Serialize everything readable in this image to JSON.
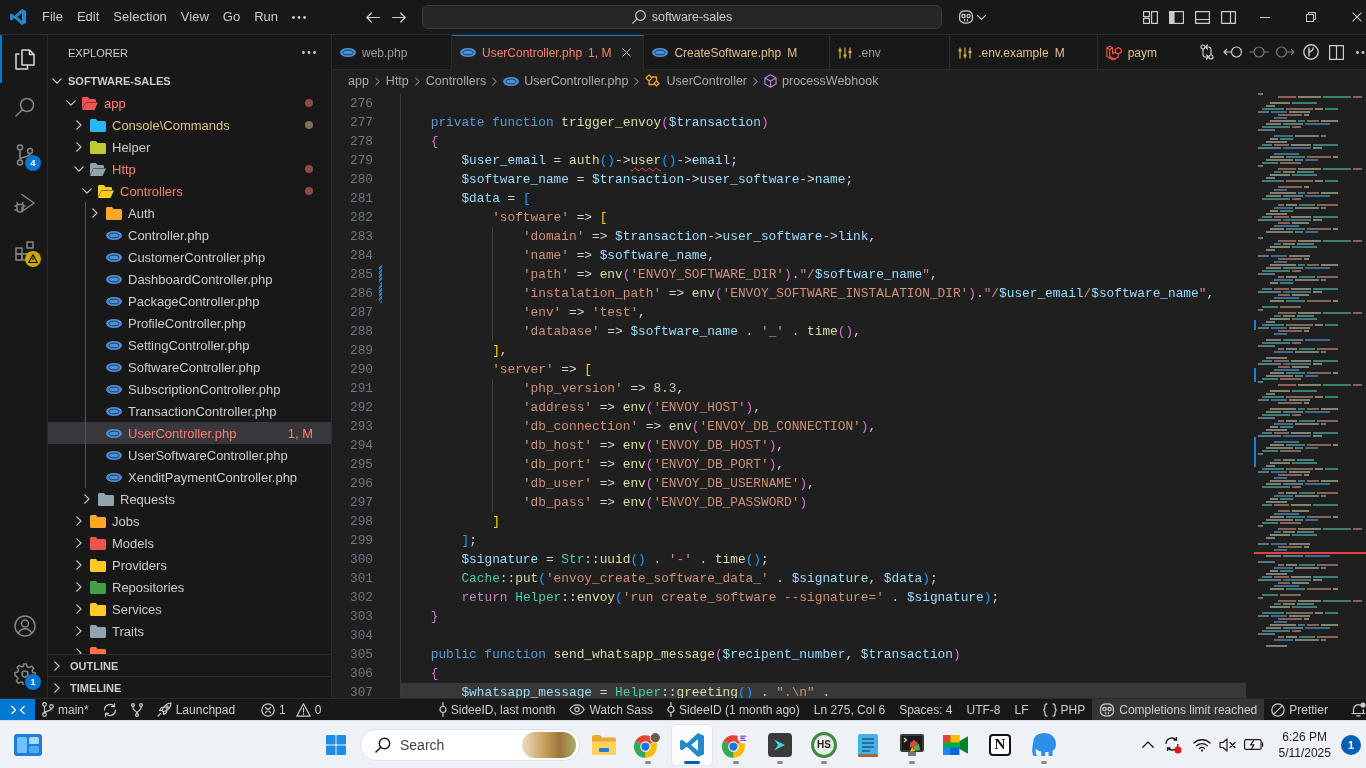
{
  "title_bar": {
    "menus": [
      "File",
      "Edit",
      "Selection",
      "View",
      "Go",
      "Run"
    ],
    "command_center": "software-sales"
  },
  "activity_bar": {
    "top": [
      {
        "kind": "explorer",
        "selected": true,
        "warning": false
      },
      {
        "kind": "search",
        "selected": false,
        "warning": false
      },
      {
        "kind": "scm",
        "selected": false,
        "warning": false,
        "badge": "4"
      },
      {
        "kind": "debug",
        "selected": false,
        "warning": false
      },
      {
        "kind": "extensions",
        "selected": false,
        "warning": true
      }
    ],
    "bottom": [
      {
        "kind": "account"
      },
      {
        "kind": "manage",
        "badge": "1"
      }
    ]
  },
  "explorer": {
    "title": "EXPLORER",
    "folder": {
      "name": "SOFTWARE-SALES",
      "expanded": true
    },
    "tree": [
      {
        "name": "app",
        "kind": "folder",
        "color": "#ef5350",
        "expanded": true,
        "selected": false,
        "error": true,
        "modified": false,
        "children": [
          {
            "name": "Console\\Commands",
            "kind": "folder",
            "color": "#29b6f6",
            "expanded": false,
            "selected": false,
            "error": false,
            "modified": true
          },
          {
            "name": "Helper",
            "kind": "folder",
            "color": "#c0ca33",
            "expanded": false,
            "selected": false,
            "error": false,
            "modified": false
          },
          {
            "name": "Http",
            "kind": "folder",
            "color": "#90a4ae",
            "expanded": true,
            "selected": false,
            "error": true,
            "modified": false,
            "children": [
              {
                "name": "Controllers",
                "kind": "folder",
                "color": "#ffca28",
                "expanded": true,
                "selected": false,
                "error": true,
                "modified": false,
                "children": [
                  {
                    "name": "Auth",
                    "kind": "folder",
                    "color": "#ffa726",
                    "expanded": false,
                    "selected": false,
                    "error": false,
                    "modified": false
                  },
                  {
                    "name": "Controller.php",
                    "kind": "file",
                    "selected": false,
                    "error": false,
                    "modified": false
                  },
                  {
                    "name": "CustomerController.php",
                    "kind": "file",
                    "selected": false,
                    "error": false,
                    "modified": false
                  },
                  {
                    "name": "DashboardController.php",
                    "kind": "file",
                    "selected": false,
                    "error": false,
                    "modified": false
                  },
                  {
                    "name": "PackageController.php",
                    "kind": "file",
                    "selected": false,
                    "error": false,
                    "modified": false
                  },
                  {
                    "name": "ProfileController.php",
                    "kind": "file",
                    "selected": false,
                    "error": false,
                    "modified": false
                  },
                  {
                    "name": "SettingController.php",
                    "kind": "file",
                    "selected": false,
                    "error": false,
                    "modified": false
                  },
                  {
                    "name": "SoftwareController.php",
                    "kind": "file",
                    "selected": false,
                    "error": false,
                    "modified": false
                  },
                  {
                    "name": "SubscriptionController.php",
                    "kind": "file",
                    "selected": false,
                    "error": false,
                    "modified": false
                  },
                  {
                    "name": "TransactionController.php",
                    "kind": "file",
                    "selected": false,
                    "error": false,
                    "modified": false
                  },
                  {
                    "name": "UserController.php",
                    "kind": "file",
                    "selected": true,
                    "error": true,
                    "modified": false,
                    "badge": "1, M"
                  },
                  {
                    "name": "UserSoftwareController.php",
                    "kind": "file",
                    "selected": false,
                    "error": false,
                    "modified": false
                  },
                  {
                    "name": "XenditPaymentController.php",
                    "kind": "file",
                    "selected": false,
                    "error": false,
                    "modified": false
                  }
                ]
              },
              {
                "name": "Requests",
                "kind": "folder",
                "color": "#90a4ae",
                "expanded": false,
                "selected": false,
                "error": false,
                "modified": false
              }
            ]
          },
          {
            "name": "Jobs",
            "kind": "folder",
            "color": "#ffa726",
            "expanded": false,
            "selected": false,
            "error": false,
            "modified": false
          },
          {
            "name": "Models",
            "kind": "folder",
            "color": "#ef5350",
            "expanded": false,
            "selected": false,
            "error": false,
            "modified": false
          },
          {
            "name": "Providers",
            "kind": "folder",
            "color": "#ffca28",
            "expanded": false,
            "selected": false,
            "error": false,
            "modified": false
          },
          {
            "name": "Repositories",
            "kind": "folder",
            "color": "#43a047",
            "expanded": false,
            "selected": false,
            "error": false,
            "modified": false
          },
          {
            "name": "Services",
            "kind": "folder",
            "color": "#ffca28",
            "expanded": false,
            "selected": false,
            "error": false,
            "modified": false
          },
          {
            "name": "Traits",
            "kind": "folder",
            "color": "#90a4ae",
            "expanded": false,
            "selected": false,
            "error": false,
            "modified": false
          },
          {
            "kind": "folder",
            "color": "#ff7043",
            "expanded": false,
            "selected": false,
            "error": false,
            "modified": false
          }
        ]
      }
    ],
    "sections": [
      {
        "name": "OUTLINE",
        "expanded": false
      },
      {
        "name": "TIMELINE",
        "expanded": false
      }
    ]
  },
  "tabs": [
    {
      "label": "web.php",
      "kind": "php",
      "selected": false,
      "error": false,
      "modified": false
    },
    {
      "label": "UserController.php",
      "kind": "php",
      "selected": true,
      "error": true,
      "modified": false,
      "badge": "1, M"
    },
    {
      "label": "CreateSoftware.php",
      "kind": "php",
      "selected": false,
      "error": false,
      "modified": true,
      "badge": "M"
    },
    {
      "label": ".env",
      "kind": "env",
      "selected": false,
      "error": false,
      "modified": false
    },
    {
      "label": ".env.example",
      "kind": "env",
      "selected": false,
      "error": false,
      "modified": true,
      "badge": "M"
    },
    {
      "label": "paym",
      "kind": "laravel",
      "selected": false,
      "error": false,
      "modified": true
    }
  ],
  "breadcrumbs": [
    {
      "label": "app",
      "kind": "folder"
    },
    {
      "label": "Http",
      "kind": "folder"
    },
    {
      "label": "Controllers",
      "kind": "folder"
    },
    {
      "label": "UserController.php",
      "kind": "php"
    },
    {
      "label": "UserController",
      "kind": "class"
    },
    {
      "label": "processWebhook",
      "kind": "method"
    }
  ],
  "editor": {
    "lines": [
      {
        "number": "276",
        "modified": false,
        "highlighted": false
      },
      {
        "number": "277",
        "modified": false,
        "highlighted": false,
        "tokens": [
          {
            "kind": "keyword",
            "text": "    private function "
          },
          {
            "kind": "function",
            "text": "trigger_envoy"
          },
          {
            "kind": "bracket2",
            "text": "("
          },
          {
            "kind": "variable",
            "text": "$transaction"
          },
          {
            "kind": "bracket2",
            "text": ")"
          }
        ]
      },
      {
        "number": "278",
        "modified": false,
        "highlighted": false,
        "tokens": [
          {
            "kind": "bracket2",
            "text": "    {"
          }
        ]
      },
      {
        "number": "279",
        "modified": false,
        "highlighted": false,
        "tokens": [
          {
            "kind": "variable",
            "text": "        $user_email"
          },
          {
            "kind": "plain",
            "text": " = "
          },
          {
            "kind": "function",
            "text": "auth"
          },
          {
            "kind": "bracket3",
            "text": "()"
          },
          {
            "kind": "plain",
            "text": "->"
          },
          {
            "kind": "flagged",
            "text": "user"
          },
          {
            "kind": "bracket3",
            "text": "()"
          },
          {
            "kind": "plain",
            "text": "->"
          },
          {
            "kind": "variable",
            "text": "email"
          },
          {
            "kind": "plain",
            "text": ";"
          }
        ]
      },
      {
        "number": "280",
        "modified": false,
        "highlighted": false,
        "tokens": [
          {
            "kind": "variable",
            "text": "        $software_name"
          },
          {
            "kind": "plain",
            "text": " = "
          },
          {
            "kind": "variable",
            "text": "$transaction"
          },
          {
            "kind": "plain",
            "text": "->"
          },
          {
            "kind": "variable",
            "text": "user_software"
          },
          {
            "kind": "plain",
            "text": "->"
          },
          {
            "kind": "variable",
            "text": "name"
          },
          {
            "kind": "plain",
            "text": ";"
          }
        ]
      },
      {
        "number": "281",
        "modified": false,
        "highlighted": false,
        "tokens": [
          {
            "kind": "variable",
            "text": "        $data"
          },
          {
            "kind": "plain",
            "text": " = "
          },
          {
            "kind": "bracket3",
            "text": "["
          }
        ]
      },
      {
        "number": "282",
        "modified": false,
        "highlighted": false,
        "tokens": [
          {
            "kind": "string",
            "text": "            'software'"
          },
          {
            "kind": "plain",
            "text": " => "
          },
          {
            "kind": "bracket1",
            "text": "["
          }
        ]
      },
      {
        "number": "283",
        "modified": false,
        "highlighted": false,
        "tokens": [
          {
            "kind": "string",
            "text": "                'domain'"
          },
          {
            "kind": "plain",
            "text": " => "
          },
          {
            "kind": "variable",
            "text": "$transaction"
          },
          {
            "kind": "plain",
            "text": "->"
          },
          {
            "kind": "variable",
            "text": "user_software"
          },
          {
            "kind": "plain",
            "text": "->"
          },
          {
            "kind": "variable",
            "text": "link"
          },
          {
            "kind": "plain",
            "text": ","
          }
        ]
      },
      {
        "number": "284",
        "modified": false,
        "highlighted": false,
        "tokens": [
          {
            "kind": "string",
            "text": "                'name'"
          },
          {
            "kind": "plain",
            "text": " => "
          },
          {
            "kind": "variable",
            "text": "$software_name"
          },
          {
            "kind": "plain",
            "text": ","
          }
        ]
      },
      {
        "number": "285",
        "modified": true,
        "highlighted": false,
        "tokens": [
          {
            "kind": "string",
            "text": "                'path'"
          },
          {
            "kind": "plain",
            "text": " => "
          },
          {
            "kind": "function",
            "text": "env"
          },
          {
            "kind": "bracket2",
            "text": "("
          },
          {
            "kind": "string",
            "text": "'ENVOY_SOFTWARE_DIR'"
          },
          {
            "kind": "bracket2",
            "text": ")"
          },
          {
            "kind": "plain",
            "text": "."
          },
          {
            "kind": "string",
            "text": "\"/"
          },
          {
            "kind": "variable",
            "text": "$software_name"
          },
          {
            "kind": "string",
            "text": "\""
          },
          {
            "kind": "plain",
            "text": ","
          }
        ]
      },
      {
        "number": "286",
        "modified": true,
        "highlighted": false,
        "tokens": [
          {
            "kind": "string",
            "text": "                'instalation_path'"
          },
          {
            "kind": "plain",
            "text": " => "
          },
          {
            "kind": "function",
            "text": "env"
          },
          {
            "kind": "bracket2",
            "text": "("
          },
          {
            "kind": "string",
            "text": "'ENVOY_SOFTWARE_INSTALATION_DIR'"
          },
          {
            "kind": "bracket2",
            "text": ")"
          },
          {
            "kind": "plain",
            "text": "."
          },
          {
            "kind": "string",
            "text": "\"/"
          },
          {
            "kind": "variable",
            "text": "$user_email"
          },
          {
            "kind": "string",
            "text": "/"
          },
          {
            "kind": "variable",
            "text": "$software_name"
          },
          {
            "kind": "string",
            "text": "\""
          },
          {
            "kind": "plain",
            "text": ","
          }
        ]
      },
      {
        "number": "287",
        "modified": false,
        "highlighted": false,
        "tokens": [
          {
            "kind": "string",
            "text": "                'env'"
          },
          {
            "kind": "plain",
            "text": " => "
          },
          {
            "kind": "string",
            "text": "'test'"
          },
          {
            "kind": "plain",
            "text": ","
          }
        ]
      },
      {
        "number": "288",
        "modified": false,
        "highlighted": false,
        "tokens": [
          {
            "kind": "string",
            "text": "                'database'"
          },
          {
            "kind": "plain",
            "text": " => "
          },
          {
            "kind": "variable",
            "text": "$software_name"
          },
          {
            "kind": "plain",
            "text": " . "
          },
          {
            "kind": "string",
            "text": "'_'"
          },
          {
            "kind": "plain",
            "text": " . "
          },
          {
            "kind": "function",
            "text": "time"
          },
          {
            "kind": "bracket2",
            "text": "()"
          },
          {
            "kind": "plain",
            "text": ","
          }
        ]
      },
      {
        "number": "289",
        "modified": false,
        "highlighted": false,
        "tokens": [
          {
            "kind": "bracket1",
            "text": "            ]"
          },
          {
            "kind": "plain",
            "text": ","
          }
        ]
      },
      {
        "number": "290",
        "modified": false,
        "highlighted": false,
        "tokens": [
          {
            "kind": "string",
            "text": "            'server'"
          },
          {
            "kind": "plain",
            "text": " => "
          },
          {
            "kind": "bracket1",
            "text": "["
          }
        ]
      },
      {
        "number": "291",
        "modified": false,
        "highlighted": false,
        "tokens": [
          {
            "kind": "string",
            "text": "                'php_version'"
          },
          {
            "kind": "plain",
            "text": " => "
          },
          {
            "kind": "number",
            "text": "8.3"
          },
          {
            "kind": "plain",
            "text": ","
          }
        ]
      },
      {
        "number": "292",
        "modified": false,
        "highlighted": false,
        "tokens": [
          {
            "kind": "string",
            "text": "                'address'"
          },
          {
            "kind": "plain",
            "text": " => "
          },
          {
            "kind": "function",
            "text": "env"
          },
          {
            "kind": "bracket2",
            "text": "("
          },
          {
            "kind": "string",
            "text": "'ENVOY_HOST'"
          },
          {
            "kind": "bracket2",
            "text": ")"
          },
          {
            "kind": "plain",
            "text": ","
          }
        ]
      },
      {
        "number": "293",
        "modified": false,
        "highlighted": false,
        "tokens": [
          {
            "kind": "string",
            "text": "                'db_connection'"
          },
          {
            "kind": "plain",
            "text": " => "
          },
          {
            "kind": "function",
            "text": "env"
          },
          {
            "kind": "bracket2",
            "text": "("
          },
          {
            "kind": "string",
            "text": "'ENVOY_DB_CONNECTION'"
          },
          {
            "kind": "bracket2",
            "text": ")"
          },
          {
            "kind": "plain",
            "text": ","
          }
        ]
      },
      {
        "number": "294",
        "modified": false,
        "highlighted": false,
        "tokens": [
          {
            "kind": "string",
            "text": "                'db_host'"
          },
          {
            "kind": "plain",
            "text": " => "
          },
          {
            "kind": "function",
            "text": "env"
          },
          {
            "kind": "bracket2",
            "text": "("
          },
          {
            "kind": "string",
            "text": "'ENVOY_DB_HOST'"
          },
          {
            "kind": "bracket2",
            "text": ")"
          },
          {
            "kind": "plain",
            "text": ","
          }
        ]
      },
      {
        "number": "295",
        "modified": false,
        "highlighted": false,
        "tokens": [
          {
            "kind": "string",
            "text": "                'db_port'"
          },
          {
            "kind": "plain",
            "text": " => "
          },
          {
            "kind": "function",
            "text": "env"
          },
          {
            "kind": "bracket2",
            "text": "("
          },
          {
            "kind": "string",
            "text": "'ENVOY_DB_PORT'"
          },
          {
            "kind": "bracket2",
            "text": ")"
          },
          {
            "kind": "plain",
            "text": ","
          }
        ]
      },
      {
        "number": "296",
        "modified": false,
        "highlighted": false,
        "tokens": [
          {
            "kind": "string",
            "text": "                'db_user'"
          },
          {
            "kind": "plain",
            "text": " => "
          },
          {
            "kind": "function",
            "text": "env"
          },
          {
            "kind": "bracket2",
            "text": "("
          },
          {
            "kind": "string",
            "text": "'ENVOY_DB_USERNAME'"
          },
          {
            "kind": "bracket2",
            "text": ")"
          },
          {
            "kind": "plain",
            "text": ","
          }
        ]
      },
      {
        "number": "297",
        "modified": false,
        "highlighted": false,
        "tokens": [
          {
            "kind": "string",
            "text": "                'db_pass'"
          },
          {
            "kind": "plain",
            "text": " => "
          },
          {
            "kind": "function",
            "text": "env"
          },
          {
            "kind": "bracket2",
            "text": "("
          },
          {
            "kind": "string",
            "text": "'ENVOY_DB_PASSWORD'"
          },
          {
            "kind": "bracket2",
            "text": ")"
          }
        ]
      },
      {
        "number": "298",
        "modified": false,
        "highlighted": false,
        "tokens": [
          {
            "kind": "bracket1",
            "text": "            ]"
          }
        ]
      },
      {
        "number": "299",
        "modified": false,
        "highlighted": false,
        "tokens": [
          {
            "kind": "bracket3",
            "text": "        ]"
          },
          {
            "kind": "plain",
            "text": ";"
          }
        ]
      },
      {
        "number": "300",
        "modified": false,
        "highlighted": false,
        "tokens": [
          {
            "kind": "variable",
            "text": "        $signature"
          },
          {
            "kind": "plain",
            "text": " = "
          },
          {
            "kind": "class",
            "text": "Str"
          },
          {
            "kind": "plain",
            "text": "::"
          },
          {
            "kind": "function",
            "text": "uuid"
          },
          {
            "kind": "bracket3",
            "text": "()"
          },
          {
            "kind": "plain",
            "text": " . "
          },
          {
            "kind": "string",
            "text": "'-'"
          },
          {
            "kind": "plain",
            "text": " . "
          },
          {
            "kind": "function",
            "text": "time"
          },
          {
            "kind": "bracket3",
            "text": "()"
          },
          {
            "kind": "plain",
            "text": ";"
          }
        ]
      },
      {
        "number": "301",
        "modified": false,
        "highlighted": false,
        "tokens": [
          {
            "kind": "class",
            "text": "        Cache"
          },
          {
            "kind": "plain",
            "text": "::"
          },
          {
            "kind": "function",
            "text": "put"
          },
          {
            "kind": "bracket3",
            "text": "("
          },
          {
            "kind": "string",
            "text": "'envoy_create_software_data_'"
          },
          {
            "kind": "plain",
            "text": " . "
          },
          {
            "kind": "variable",
            "text": "$signature"
          },
          {
            "kind": "plain",
            "text": ", "
          },
          {
            "kind": "variable",
            "text": "$data"
          },
          {
            "kind": "bracket3",
            "text": ")"
          },
          {
            "kind": "plain",
            "text": ";"
          }
        ]
      },
      {
        "number": "302",
        "modified": false,
        "highlighted": false,
        "tokens": [
          {
            "kind": "control",
            "text": "        return "
          },
          {
            "kind": "class",
            "text": "Helper"
          },
          {
            "kind": "plain",
            "text": "::"
          },
          {
            "kind": "function",
            "text": "envoy"
          },
          {
            "kind": "bracket3",
            "text": "("
          },
          {
            "kind": "string",
            "text": "'run create_software --signature='"
          },
          {
            "kind": "plain",
            "text": " . "
          },
          {
            "kind": "variable",
            "text": "$signature"
          },
          {
            "kind": "bracket3",
            "text": ")"
          },
          {
            "kind": "plain",
            "text": ";"
          }
        ]
      },
      {
        "number": "303",
        "modified": false,
        "highlighted": false,
        "tokens": [
          {
            "kind": "bracket2",
            "text": "    }"
          }
        ]
      },
      {
        "number": "304",
        "modified": false,
        "highlighted": false
      },
      {
        "number": "305",
        "modified": false,
        "highlighted": false,
        "tokens": [
          {
            "kind": "keyword",
            "text": "    public function "
          },
          {
            "kind": "function",
            "text": "send_whatsapp_message"
          },
          {
            "kind": "bracket2",
            "text": "("
          },
          {
            "kind": "variable",
            "text": "$recipent_number"
          },
          {
            "kind": "plain",
            "text": ", "
          },
          {
            "kind": "variable",
            "text": "$transaction"
          },
          {
            "kind": "bracket2",
            "text": ")"
          }
        ]
      },
      {
        "number": "306",
        "modified": false,
        "highlighted": false,
        "tokens": [
          {
            "kind": "bracket2",
            "text": "    {"
          }
        ]
      },
      {
        "number": "307",
        "modified": false,
        "highlighted": true,
        "tokens": [
          {
            "kind": "variable",
            "text": "        $whatsapp_message"
          },
          {
            "kind": "plain",
            "text": " = "
          },
          {
            "kind": "class",
            "text": "Helper"
          },
          {
            "kind": "plain",
            "text": "::"
          },
          {
            "kind": "function",
            "text": "greeting"
          },
          {
            "kind": "bracket3",
            "text": "()"
          },
          {
            "kind": "plain",
            "text": " . "
          },
          {
            "kind": "string",
            "text": "\".\\n\""
          },
          {
            "kind": "plain",
            "text": " ."
          }
        ]
      }
    ]
  },
  "status_bar": {
    "left": [
      {
        "kind": "remote"
      },
      {
        "kind": "branch",
        "text": "main*"
      },
      {
        "kind": "sync"
      },
      {
        "kind": "graph"
      },
      {
        "kind": "launchpad",
        "text": "Launchpad"
      },
      {
        "kind": "problems",
        "errors": "1",
        "warnings": "0"
      }
    ],
    "right": [
      {
        "kind": "commit",
        "text": "SideeID, last month",
        "highlighted": false
      },
      {
        "kind": "eye",
        "text": "Watch Sass",
        "highlighted": false
      },
      {
        "kind": "commit",
        "text": "SideeID (1 month ago)",
        "highlighted": false
      },
      {
        "kind": "plain",
        "text": "Ln 275, Col 6",
        "highlighted": false
      },
      {
        "kind": "plain",
        "text": "Spaces: 4",
        "highlighted": false
      },
      {
        "kind": "plain",
        "text": "UTF-8",
        "highlighted": false
      },
      {
        "kind": "plain",
        "text": "LF",
        "highlighted": false
      },
      {
        "kind": "language",
        "text": "PHP",
        "highlighted": false
      },
      {
        "kind": "copilot",
        "text": "Completions limit reached",
        "highlighted": true
      },
      {
        "kind": "blocked",
        "text": "Prettier",
        "highlighted": false
      },
      {
        "kind": "bell",
        "highlighted": false
      }
    ]
  },
  "taskbar": {
    "search": {
      "placeholder": "Search"
    },
    "apps": [
      {
        "kind": "files",
        "running": false,
        "active": false
      },
      {
        "kind": "chrome",
        "running": true,
        "active": false
      },
      {
        "kind": "vscode",
        "running": true,
        "active": true
      },
      {
        "kind": "chromework",
        "running": true,
        "active": false
      },
      {
        "kind": "terminal",
        "running": true,
        "active": false
      },
      {
        "kind": "hs",
        "label": "HS",
        "running": true,
        "active": false
      },
      {
        "kind": "notepad",
        "running": false,
        "active": false
      },
      {
        "kind": "screen",
        "running": true,
        "active": false
      },
      {
        "kind": "meet",
        "running": false,
        "active": false
      },
      {
        "kind": "notion",
        "label": "N",
        "running": false,
        "active": false
      },
      {
        "kind": "elephant",
        "running": true,
        "active": false
      }
    ],
    "tray": {
      "time": "6:26 PM",
      "date": "5/11/2025",
      "notifications": "1"
    }
  }
}
